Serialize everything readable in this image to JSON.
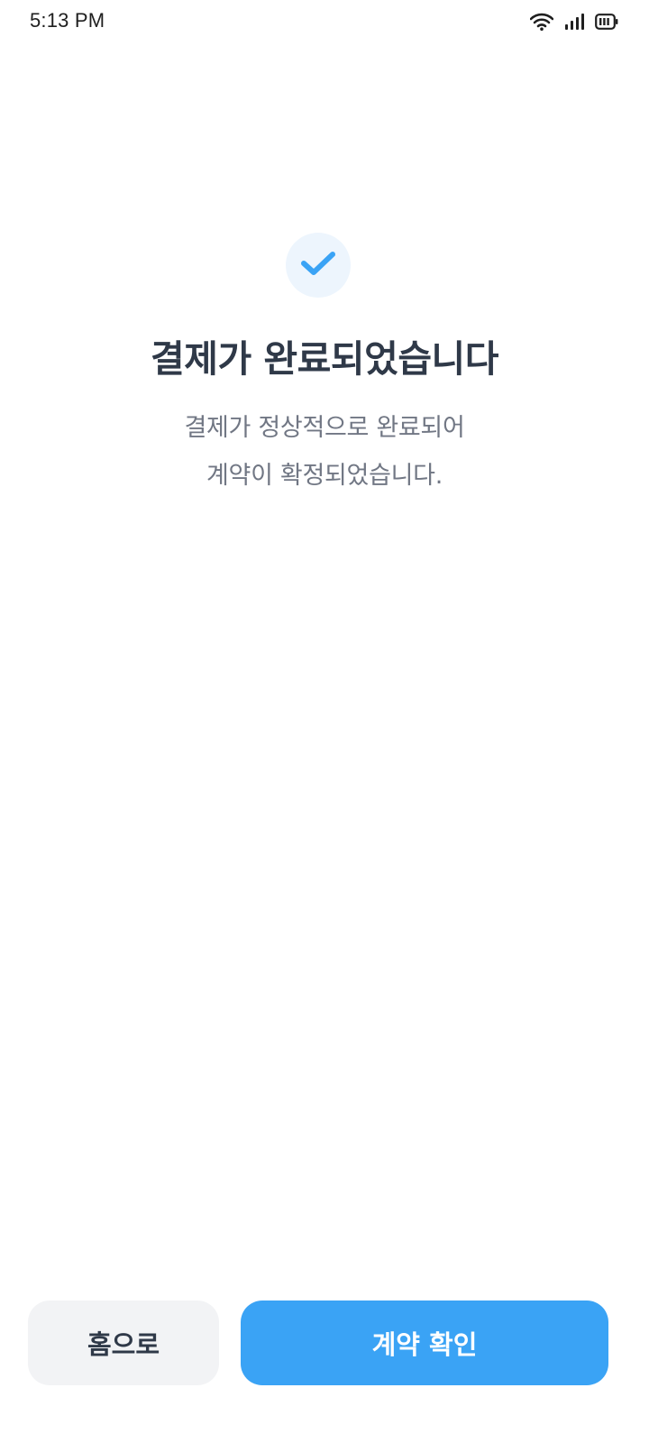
{
  "status_bar": {
    "time": "5:13 PM",
    "icons": [
      "wifi-icon",
      "signal-icon",
      "battery-icon"
    ]
  },
  "success": {
    "icon": "check-icon",
    "accent_color": "#3aa3f5",
    "title": "결제가 완료되었습니다",
    "description_line1": "결제가 정상적으로 완료되어",
    "description_line2": "계약이 확정되었습니다."
  },
  "actions": {
    "home_label": "홈으로",
    "confirm_label": "계약 확인"
  }
}
